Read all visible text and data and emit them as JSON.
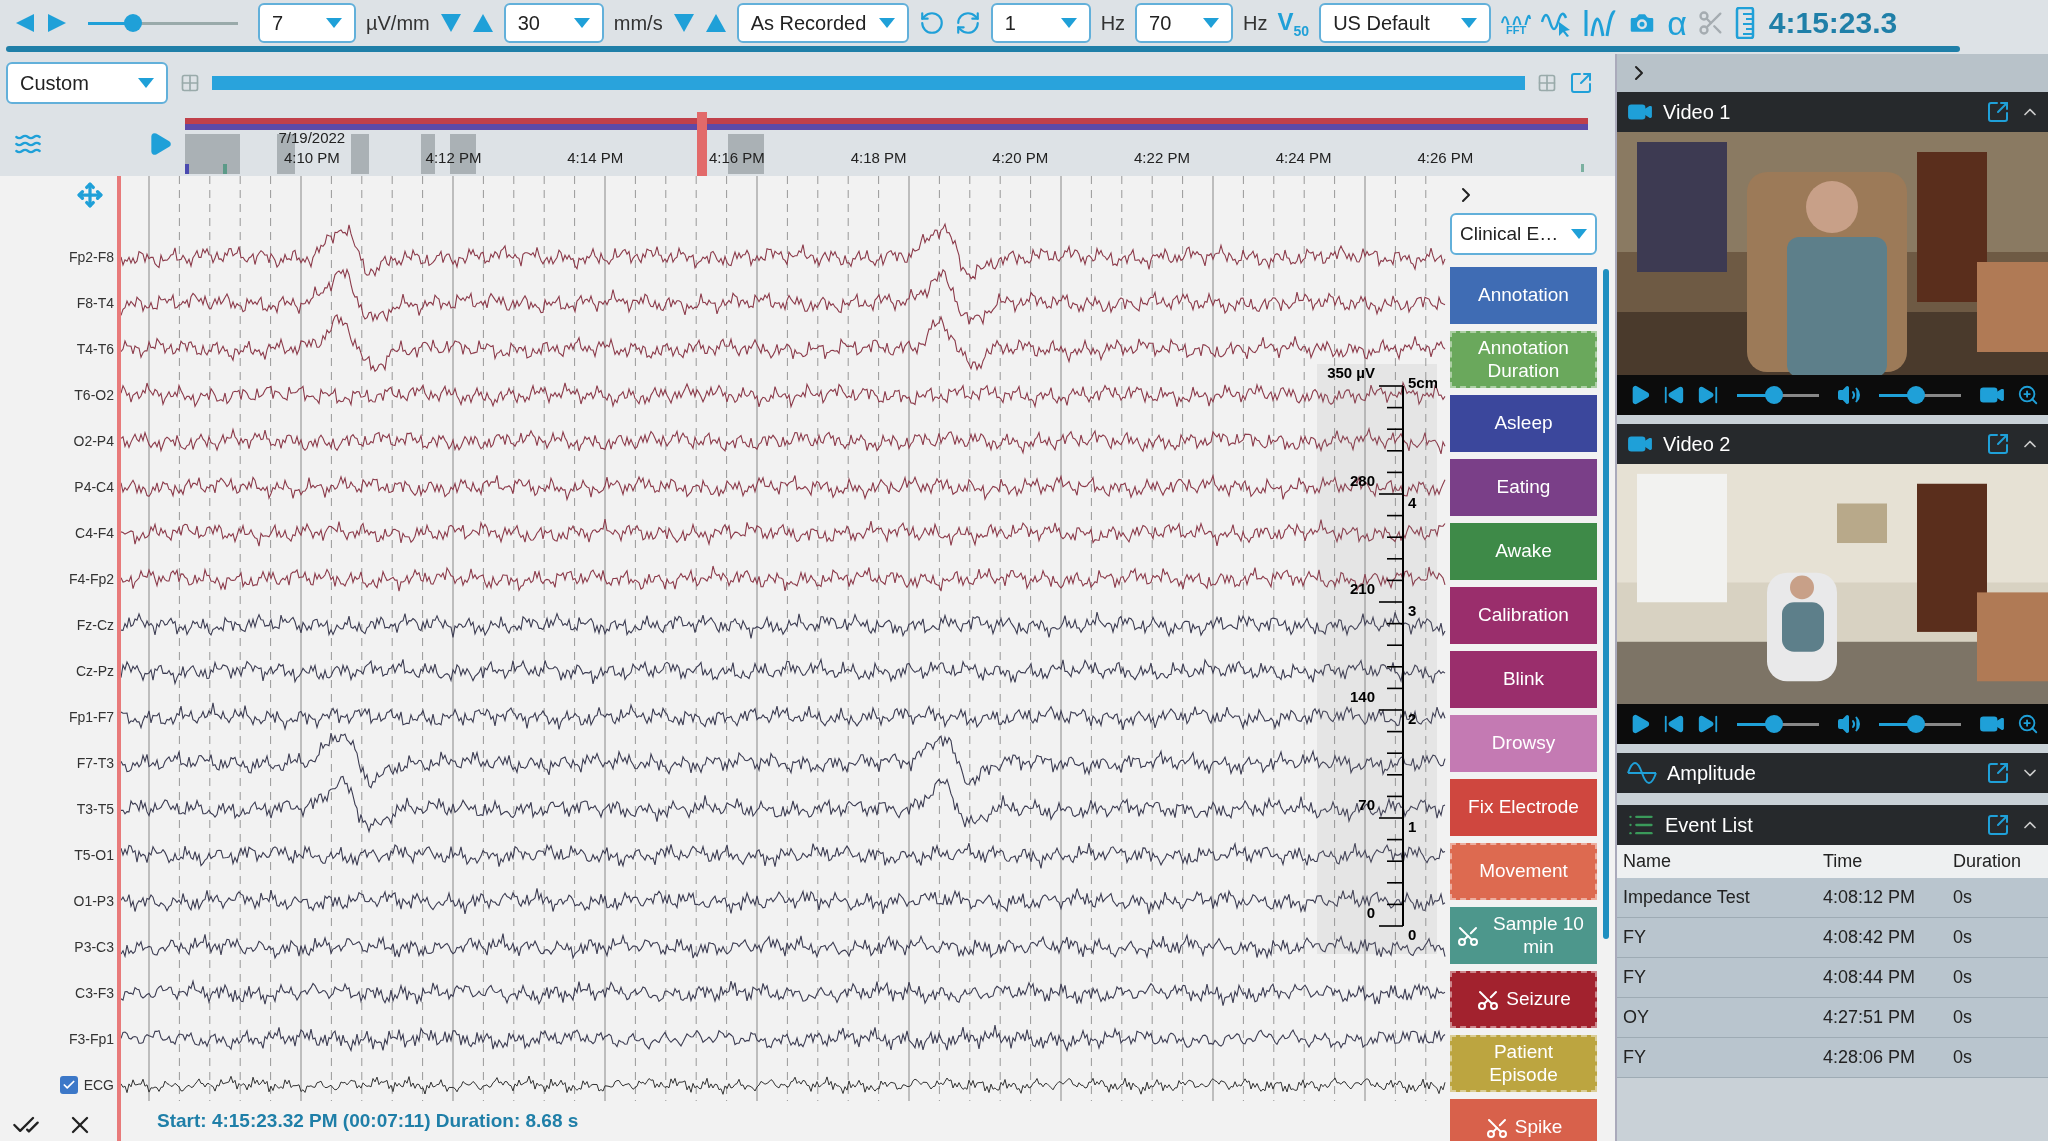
{
  "toolbar": {
    "zoom": {
      "level": 0.3
    },
    "sensitivity": {
      "value": "7",
      "unit": "µV/mm"
    },
    "speed": {
      "value": "30",
      "unit": "mm/s"
    },
    "montage": "As Recorded",
    "low_filter": {
      "value": "1",
      "unit": "Hz"
    },
    "high_filter": {
      "value": "70",
      "unit": "Hz"
    },
    "notch": "V$_{50}$",
    "preset": "US Default",
    "fft_label": "FFT",
    "alpha": "α",
    "scissors_disabled": true,
    "clock": "4:15:23.3"
  },
  "view": {
    "layout": "Custom"
  },
  "timeline": {
    "date": "7/19/2022",
    "ticks": [
      "4:10 PM",
      "4:12 PM",
      "4:14 PM",
      "4:16 PM",
      "4:18 PM",
      "4:20 PM",
      "4:22 PM",
      "4:24 PM",
      "4:26 PM"
    ]
  },
  "channels": [
    "Fp2-F8",
    "F8-T4",
    "T4-T6",
    "T6-O2",
    "O2-P4",
    "P4-C4",
    "C4-F4",
    "F4-Fp2",
    "Fz-Cz",
    "Cz-Pz",
    "Fp1-F7",
    "F7-T3",
    "T3-T5",
    "T5-O1",
    "O1-P3",
    "P3-C3",
    "C3-F3",
    "F3-Fp1"
  ],
  "ecg": {
    "label": "ECG",
    "checked": true
  },
  "scale": {
    "microvolts": [
      "350 µV",
      "280",
      "210",
      "140",
      "70",
      "0"
    ],
    "centimeters": [
      "5cm",
      "4",
      "3",
      "2",
      "1",
      "0"
    ]
  },
  "status": "Start: 4:15:23.32 PM (00:07:11) Duration: 8.68 s",
  "event_types": {
    "category": "Clinical E…",
    "buttons": [
      {
        "label": "Annotation",
        "color": "#3f6cb4",
        "duration": false,
        "clip": false
      },
      {
        "label": "Annotation Duration",
        "color": "#6aa85c",
        "duration": true,
        "clip": false
      },
      {
        "label": "Asleep",
        "color": "#3b479c",
        "duration": false,
        "clip": false
      },
      {
        "label": "Eating",
        "color": "#7a3f88",
        "duration": false,
        "clip": false
      },
      {
        "label": "Awake",
        "color": "#3e8a48",
        "duration": false,
        "clip": false
      },
      {
        "label": "Calibration",
        "color": "#9a2e6c",
        "duration": false,
        "clip": false
      },
      {
        "label": "Blink",
        "color": "#9a2e6c",
        "duration": false,
        "clip": false
      },
      {
        "label": "Drowsy",
        "color": "#c47ab3",
        "duration": false,
        "clip": false
      },
      {
        "label": "Fix Electrode",
        "color": "#cf473f",
        "duration": false,
        "clip": false
      },
      {
        "label": "Movement",
        "color": "#dd6a50",
        "duration": true,
        "clip": false
      },
      {
        "label": "Sample 10 min",
        "color": "#4d978c",
        "duration": false,
        "clip": true
      },
      {
        "label": "Seizure",
        "color": "#a2222e",
        "duration": true,
        "clip": true
      },
      {
        "label": "Patient Episode",
        "color": "#bca540",
        "duration": true,
        "clip": false
      },
      {
        "label": "Spike",
        "color": "#d8614b",
        "duration": false,
        "clip": true
      }
    ]
  },
  "videos": [
    {
      "title": "Video 1",
      "kind": "picture",
      "seek": {
        "level": 0.45
      },
      "volume": {
        "level": 0.45
      }
    },
    {
      "title": "Video 2",
      "kind": "picture",
      "seek": {
        "level": 0.45
      },
      "volume": {
        "level": 0.45
      }
    }
  ],
  "amplitude": {
    "title": "Amplitude",
    "expanded": false
  },
  "event_list": {
    "title": "Event List",
    "expanded": true,
    "columns": [
      "Name",
      "Time",
      "Duration"
    ],
    "rows": [
      {
        "name": "Impedance Test",
        "time": "4:08:12 PM",
        "duration": "0s"
      },
      {
        "name": "FY",
        "time": "4:08:42 PM",
        "duration": "0s"
      },
      {
        "name": "FY",
        "time": "4:08:44 PM",
        "duration": "0s"
      },
      {
        "name": "OY",
        "time": "4:27:51 PM",
        "duration": "0s"
      },
      {
        "name": "FY",
        "time": "4:28:06 PM",
        "duration": "0s"
      }
    ]
  }
}
